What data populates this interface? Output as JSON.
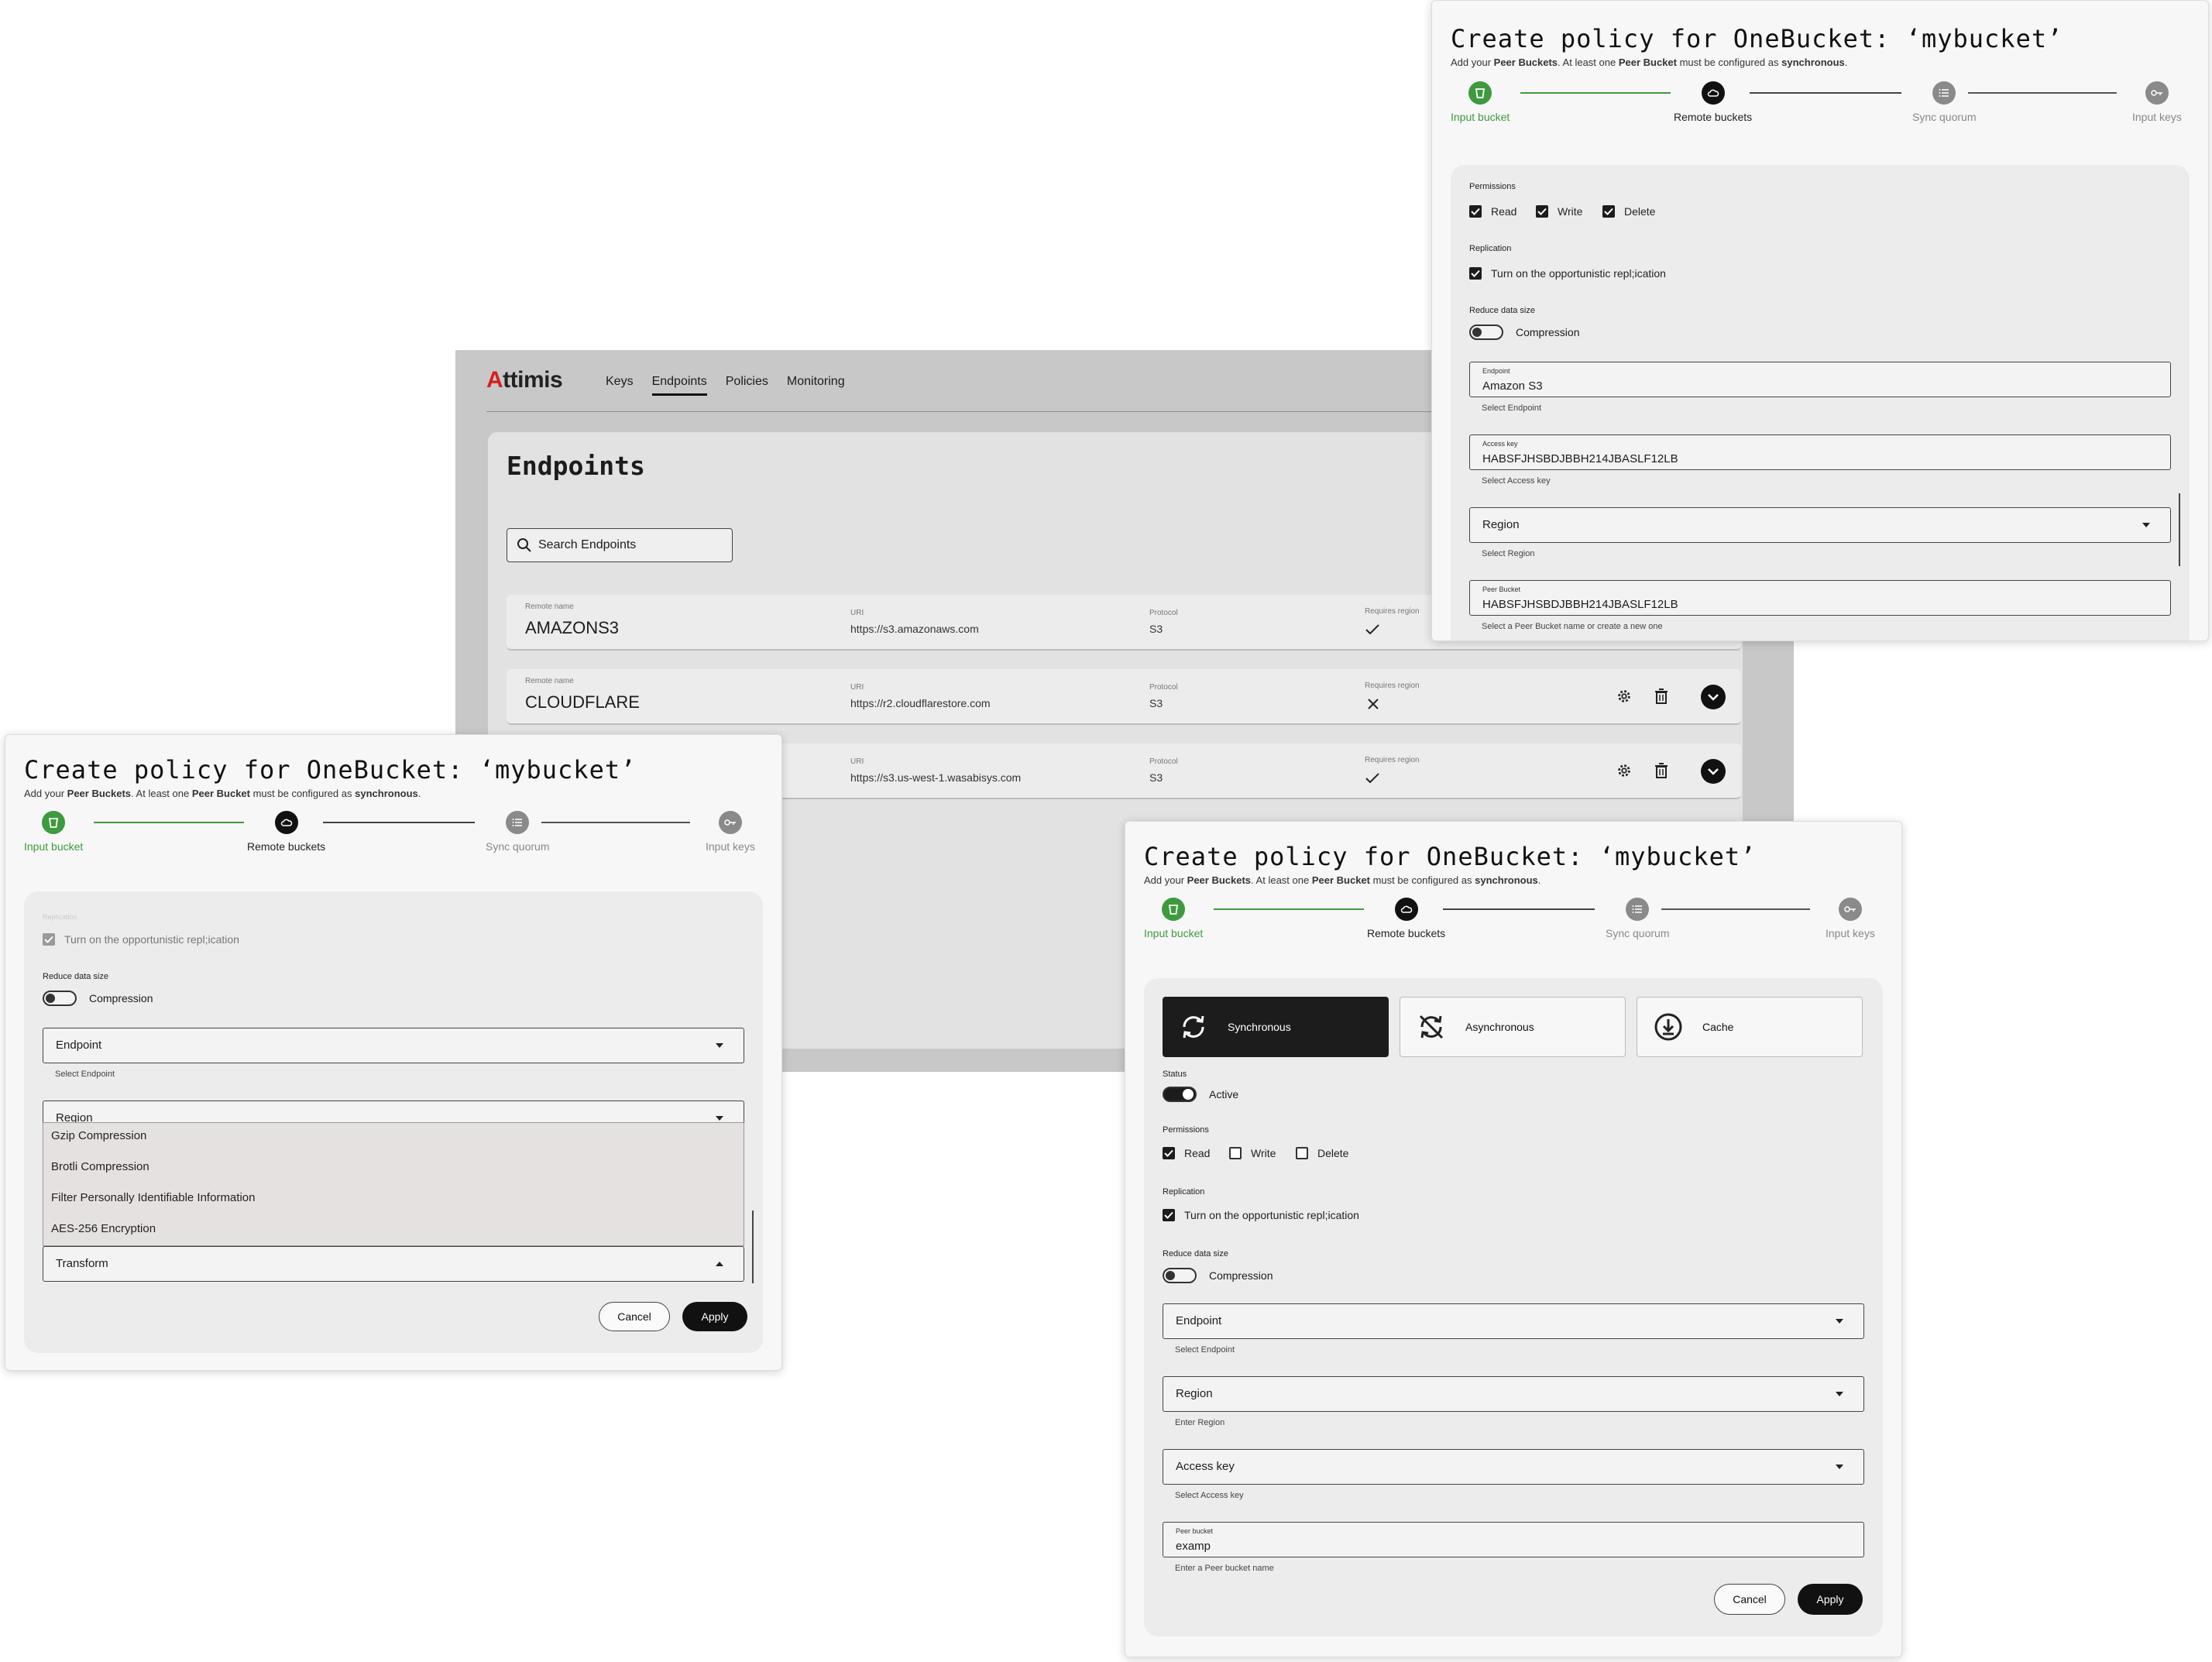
{
  "app": {
    "logo": "Attimis",
    "logo_initial": "A",
    "logo_rest": "ttimis",
    "nav": [
      "Keys",
      "Endpoints",
      "Policies",
      "Monitoring"
    ],
    "active_nav": "Endpoints",
    "page_title": "Endpoints",
    "search_placeholder": "Search Endpoints",
    "columns": {
      "remote_name": "Remote name",
      "uri": "URI",
      "protocol": "Protocol",
      "requires_region": "Requires region"
    },
    "endpoints": [
      {
        "name": "AMAZONS3",
        "uri": "https://s3.amazonaws.com",
        "protocol": "S3",
        "requires_region": true
      },
      {
        "name": "CLOUDFLARE",
        "uri": "https://r2.cloudflarestore.com",
        "protocol": "S3",
        "requires_region": false
      },
      {
        "name": "",
        "uri": "https://s3.us-west-1.wasabisys.com",
        "protocol": "S3",
        "requires_region": true
      }
    ]
  },
  "dialog_common": {
    "title": "Create policy for OneBucket: ‘mybucket’",
    "sub_1": "Add your ",
    "sub_b1": "Peer Buckets",
    "sub_2": ". At least one ",
    "sub_b2": "Peer Bucket",
    "sub_3": " must be configured as ",
    "sub_b3": "synchronous",
    "sub_4": ".",
    "steps": [
      "Input bucket",
      "Remote buckets",
      "Sync quorum",
      "Input keys"
    ]
  },
  "dialog_top": {
    "permissions_label": "Permissions",
    "read": "Read",
    "write": "Write",
    "delete": "Delete",
    "replication_label": "Replication",
    "replication_option": "Turn on the opportunistic repl;ication",
    "reduce_label": "Reduce data size",
    "compression": "Compression",
    "endpoint_label": "Endpoint",
    "endpoint_value": "Amazon S3",
    "endpoint_help": "Select Endpoint",
    "access_label": "Access key",
    "access_value": "HABSFJHSBDJBBH214JBASLF12LB",
    "access_help": "Select Access key",
    "region_value": "Region",
    "region_help": "Select Region",
    "peer_label": "Peer Bucket",
    "peer_value": "HABSFJHSBDJBBH214JBASLF12LB",
    "peer_help": "Select a Peer Bucket name or create a new one"
  },
  "dialog_left": {
    "faded_label": "Replication",
    "replication_option": "Turn on the opportunistic repl;ication",
    "reduce_label": "Reduce data size",
    "compression": "Compression",
    "endpoint_value": "Endpoint",
    "endpoint_help": "Select Endpoint",
    "region_value": "Region",
    "menu_items": [
      "Gzip Compression",
      "Brotli Compression",
      "Filter Personally Identifiable Information",
      "AES-256 Encryption"
    ],
    "transform_value": "Transform",
    "cancel": "Cancel",
    "apply": "Apply"
  },
  "dialog_right": {
    "modes": [
      "Synchronous",
      "Asynchronous",
      "Cache"
    ],
    "status_label": "Status",
    "status_value": "Active",
    "permissions_label": "Permissions",
    "read": "Read",
    "write": "Write",
    "delete": "Delete",
    "replication_label": "Replication",
    "replication_option": "Turn on the opportunistic repl;ication",
    "reduce_label": "Reduce data size",
    "compression": "Compression",
    "endpoint_value": "Endpoint",
    "endpoint_help": "Select Endpoint",
    "region_value": "Region",
    "region_help": "Enter Region",
    "access_value": "Access key",
    "access_help": "Select Access key",
    "peer_label": "Peer bucket",
    "peer_value": "examp",
    "peer_help": "Enter a Peer bucket name",
    "cancel": "Cancel",
    "apply": "Apply"
  },
  "colors": {
    "accent_green": "#3e9a3e",
    "dark": "#1c1c1c",
    "logo_red": "#d71f1f"
  }
}
